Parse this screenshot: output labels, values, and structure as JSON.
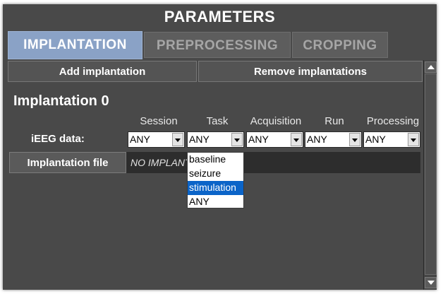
{
  "window": {
    "title": "PARAMETERS"
  },
  "tabs": [
    {
      "label": "IMPLANTATION",
      "active": true
    },
    {
      "label": "PREPROCESSING",
      "active": false
    },
    {
      "label": "CROPPING",
      "active": false
    }
  ],
  "toolbar": {
    "add_label": "Add implantation",
    "remove_label": "Remove implantations"
  },
  "implantation": {
    "title": "Implantation 0",
    "columns": [
      "Session",
      "Task",
      "Acquisition",
      "Run",
      "Processing"
    ],
    "ieeg_label": "iEEG data:",
    "selectors": [
      {
        "value": "ANY"
      },
      {
        "value": "ANY"
      },
      {
        "value": "ANY"
      },
      {
        "value": "ANY"
      },
      {
        "value": "ANY"
      }
    ],
    "file_button_label": "Implantation file",
    "file_value": "NO IMPLANTATION FILE"
  },
  "task_dropdown": {
    "options": [
      "baseline",
      "seizure",
      "stimulation",
      "ANY"
    ],
    "highlighted": "stimulation"
  },
  "colors": {
    "window_bg": "#494949",
    "active_tab": "#8aa2c6",
    "highlight": "#0b64c8"
  }
}
